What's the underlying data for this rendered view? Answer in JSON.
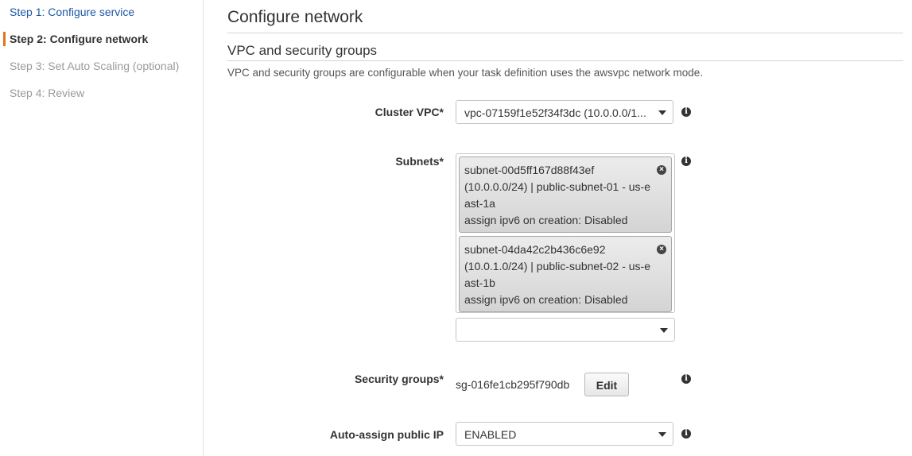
{
  "sidebar": {
    "steps": [
      {
        "label": "Step 1: Configure service",
        "state": "link"
      },
      {
        "label": "Step 2: Configure network",
        "state": "active"
      },
      {
        "label": "Step 3: Set Auto Scaling (optional)",
        "state": "disabled"
      },
      {
        "label": "Step 4: Review",
        "state": "disabled"
      }
    ]
  },
  "main": {
    "page_title": "Configure network",
    "section_title": "VPC and security groups",
    "description": "VPC and security groups are configurable when your task definition uses the awsvpc network mode.",
    "cluster_vpc": {
      "label": "Cluster VPC*",
      "value": "vpc-07159f1e52f34f3dc (10.0.0.0/1..."
    },
    "subnets": {
      "label": "Subnets*",
      "selected": [
        {
          "lines": [
            "subnet-00d5ff167d88f43ef",
            "(10.0.0.0/24) | public-subnet-01 - us-e",
            "ast-1a",
            "assign ipv6 on creation: Disabled"
          ]
        },
        {
          "lines": [
            "subnet-04da42c2b436c6e92",
            "(10.0.1.0/24) | public-subnet-02 - us-e",
            "ast-1b",
            "assign ipv6 on creation: Disabled"
          ]
        }
      ],
      "add_value": ""
    },
    "security_groups": {
      "label": "Security groups*",
      "value": "sg-016fe1cb295f790db",
      "edit_label": "Edit"
    },
    "auto_assign_ip": {
      "label": "Auto-assign public IP",
      "value": "ENABLED"
    }
  },
  "icons": {
    "info": "info-icon",
    "remove": "remove-chip-icon",
    "caret": "caret-down-icon"
  },
  "colors": {
    "link": "#1d58a8",
    "active_indicator": "#e7711b",
    "disabled": "#9a9a9a"
  }
}
